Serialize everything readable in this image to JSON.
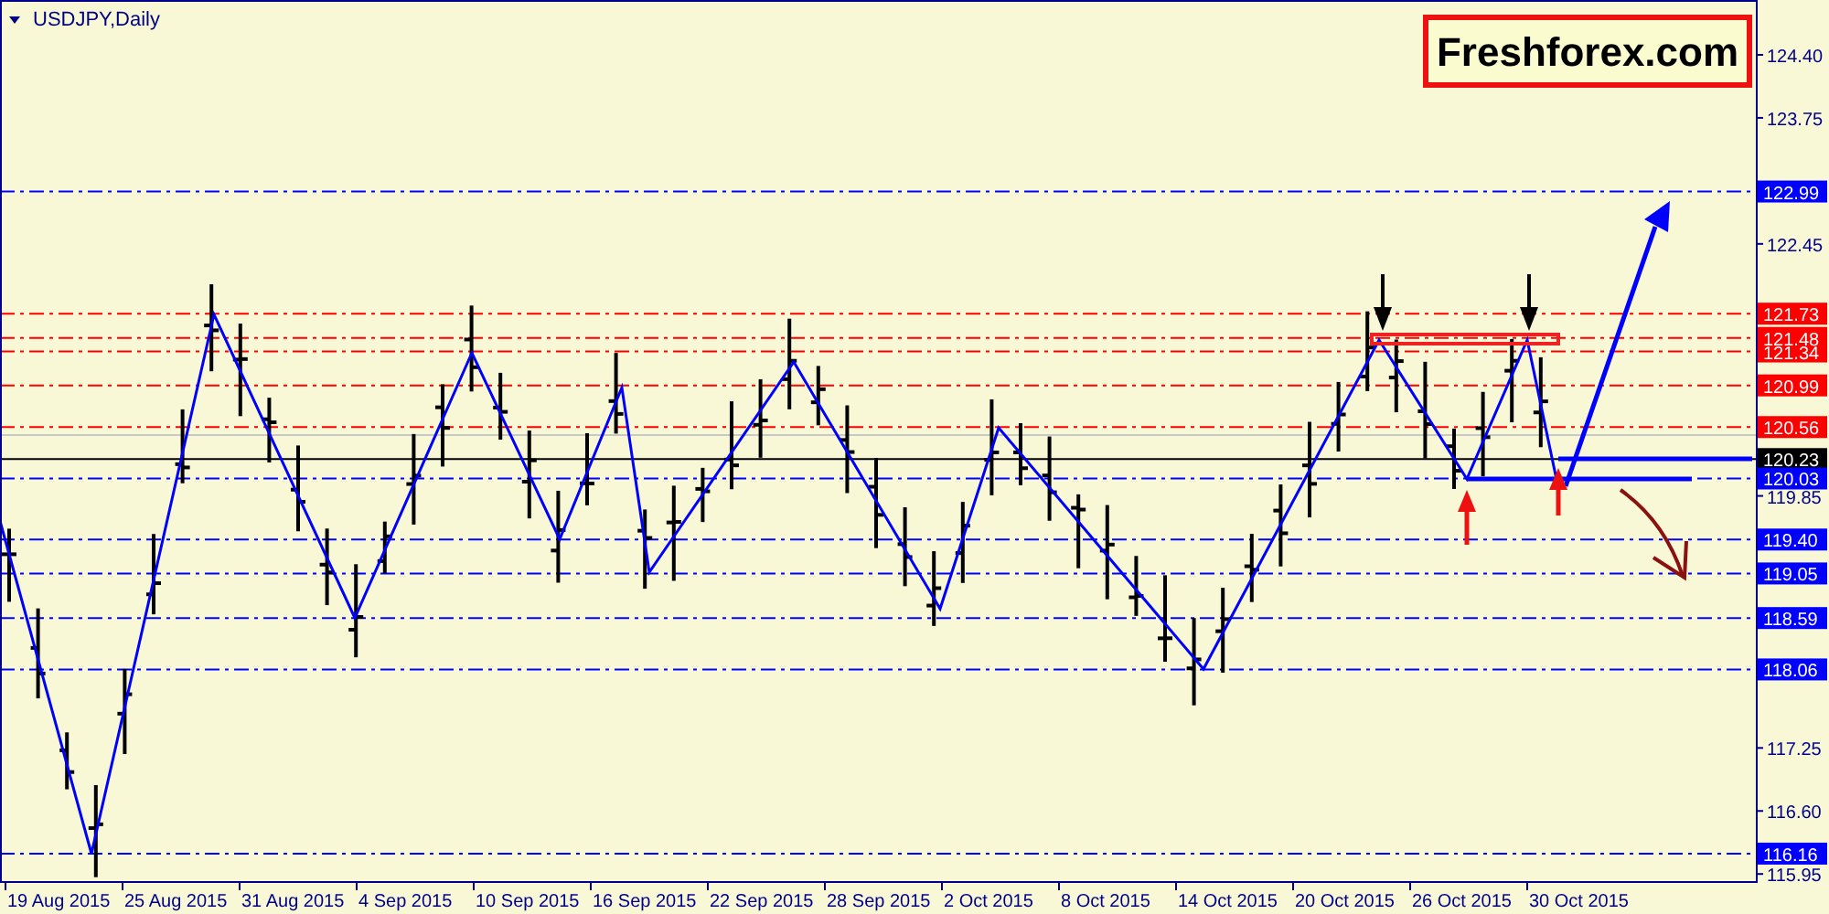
{
  "chart": {
    "title": "USDJPY,Daily",
    "logo": "Freshforex.com",
    "price_ticks": [
      "124.40",
      "123.75",
      "122.45",
      "119.85",
      "117.25",
      "116.60",
      "115.95"
    ],
    "price_levels": [
      {
        "label": "122.99",
        "kind": "level",
        "color": "#0000ff"
      },
      {
        "label": "121.73",
        "kind": "level",
        "color": "#ff0000"
      },
      {
        "label": "121.48",
        "kind": "level",
        "color": "#ff0000"
      },
      {
        "label": "121.34",
        "kind": "level",
        "color": "#ff0000"
      },
      {
        "label": "120.99",
        "kind": "level",
        "color": "#ff0000"
      },
      {
        "label": "120.56",
        "kind": "level",
        "color": "#ff0000"
      },
      {
        "label": "120.23",
        "kind": "current",
        "color": "#000000"
      },
      {
        "label": "120.03",
        "kind": "level",
        "color": "#0000ff"
      },
      {
        "label": "119.40",
        "kind": "level",
        "color": "#0000ff"
      },
      {
        "label": "119.05",
        "kind": "level",
        "color": "#0000ff"
      },
      {
        "label": "118.59",
        "kind": "level",
        "color": "#0000ff"
      },
      {
        "label": "118.06",
        "kind": "level",
        "color": "#0000ff"
      },
      {
        "label": "116.16",
        "kind": "level",
        "color": "#0000ff"
      }
    ],
    "dates": [
      "19 Aug 2015",
      "25 Aug 2015",
      "31 Aug 2015",
      "4 Sep 2015",
      "10 Sep 2015",
      "16 Sep 2015",
      "22 Sep 2015",
      "28 Sep 2015",
      "2 Oct 2015",
      "8 Oct 2015",
      "14 Oct 2015",
      "20 Oct 2015",
      "26 Oct 2015",
      "30 Oct 2015"
    ]
  }
}
